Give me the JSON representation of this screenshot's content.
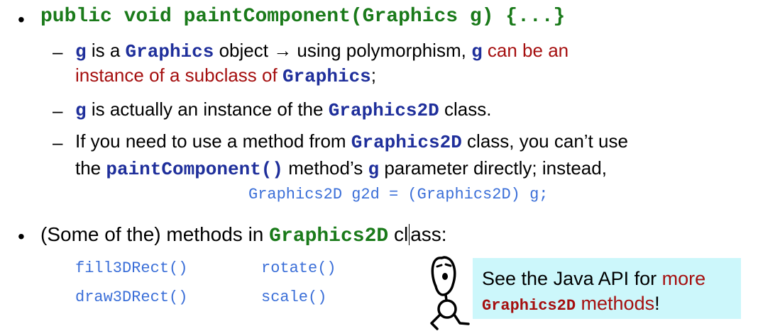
{
  "slide": {
    "heading": {
      "bullet": "•",
      "code": "public void paintComponent(Graphics g) {...}"
    },
    "sub1": {
      "dash": "–",
      "g1": "g",
      "t1": " is a ",
      "graphics": "Graphics",
      "t2": " object ",
      "arrow": "→",
      "t3": " using polymorphism, ",
      "g2": "g",
      "t4": " can be an",
      "t5": "instance of a subclass of ",
      "graphics2": "Graphics",
      "t6": ";"
    },
    "sub2": {
      "dash": "–",
      "g": "g",
      "t1": " is actually an instance of the ",
      "g2d": "Graphics2D",
      "t2": " class."
    },
    "sub3": {
      "dash": "–",
      "t1": "If you need to use a method from ",
      "g2d": "Graphics2D",
      "t2": " class, you can’t use",
      "t3": "the ",
      "pc": "paintComponent()",
      "t4": " method’s ",
      "g": "g",
      "t5": " parameter directly; instead,",
      "code": "Graphics2D g2d = (Graphics2D) g;"
    },
    "bullet2": {
      "bullet": "•",
      "t1": "(Some of the) methods in ",
      "g2d": "Graphics2D",
      "t2a": "cl",
      "t2b": "ass:"
    },
    "methods": {
      "r1c1": "fill3DRect()",
      "r1c2": "rotate()",
      "r2c1": "draw3DRect()",
      "r2c2": "scale()"
    },
    "callout": {
      "t1": "See the Java API for ",
      "t2": "more",
      "g2d": "Graphics2D",
      "t3": " methods",
      "t4": "!"
    }
  }
}
